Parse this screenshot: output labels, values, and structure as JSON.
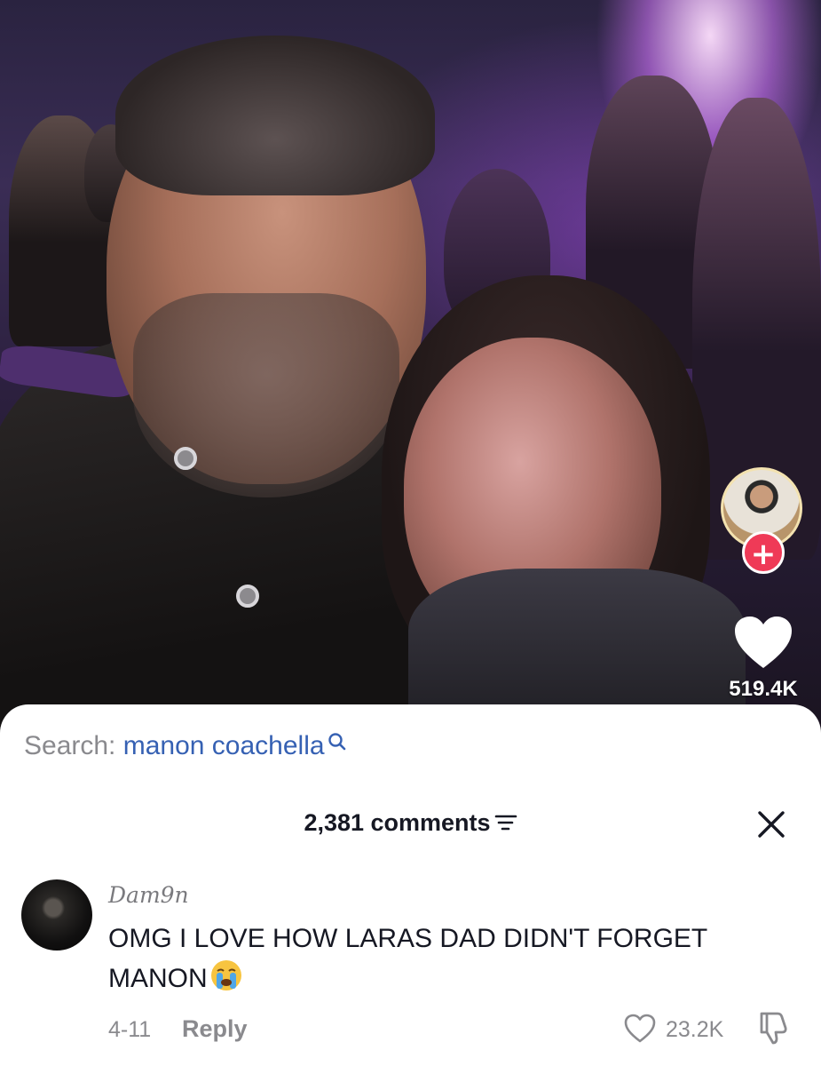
{
  "video": {
    "like_count": "519.4K",
    "follow_symbol": "+"
  },
  "search": {
    "prefix": "Search:",
    "query": "manon coachella"
  },
  "comments": {
    "count_label": "2,381 comments",
    "items": [
      {
        "username": "Dam9n",
        "text": "OMG I LOVE HOW LARAS DAD DIDN'T FORGET MANON",
        "date": "4-11",
        "reply_label": "Reply",
        "like_count": "23.2K"
      }
    ]
  },
  "colors": {
    "follow_button": "#ef3a57",
    "search_query": "#3661b3",
    "muted_text": "#8a8a8e"
  },
  "icons": [
    "search-icon",
    "filter-icon",
    "close-icon",
    "heart-icon",
    "dislike-icon",
    "crying-emoji-icon"
  ]
}
